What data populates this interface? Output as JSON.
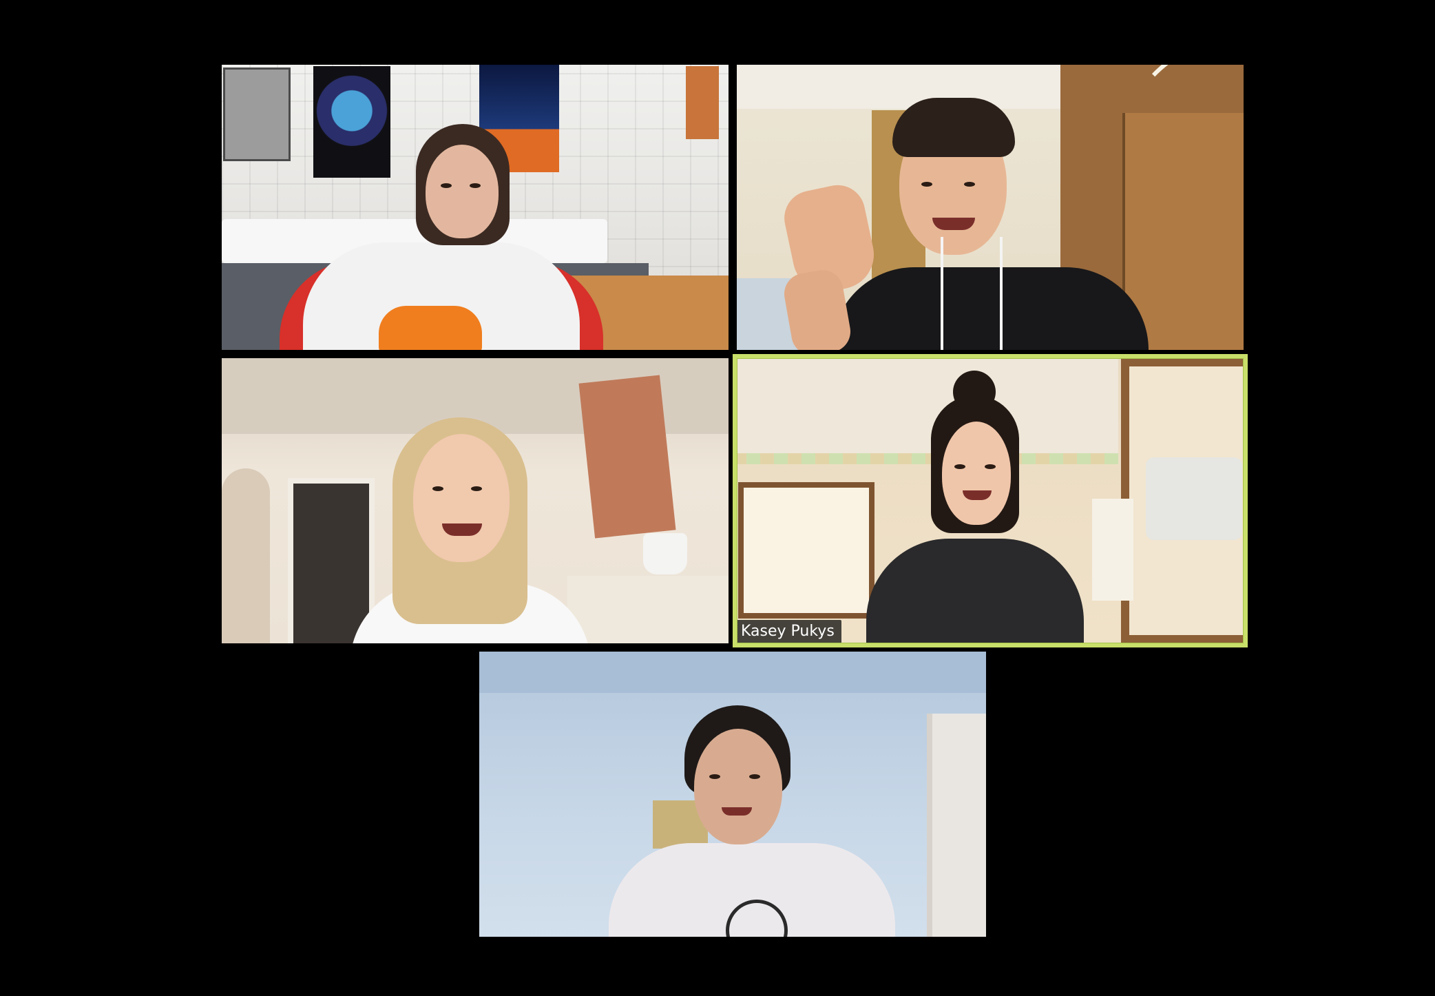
{
  "meeting": {
    "layout": "gallery-view",
    "participants": [
      {
        "id": "p1",
        "name": "",
        "speaking": false
      },
      {
        "id": "p2",
        "name": "",
        "speaking": false
      },
      {
        "id": "p3",
        "name": "",
        "speaking": false
      },
      {
        "id": "p4",
        "name": "Kasey Pukys",
        "speaking": true
      },
      {
        "id": "p5",
        "name": "",
        "speaking": false
      }
    ]
  },
  "colors": {
    "background": "#000000",
    "active_speaker_border": "#c8e06a",
    "name_tag_bg": "#141414",
    "name_tag_text": "#ffffff"
  }
}
